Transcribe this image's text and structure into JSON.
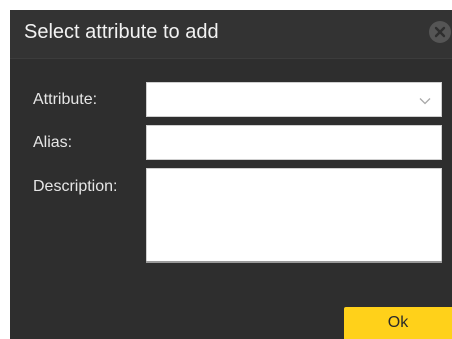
{
  "dialog": {
    "title": "Select attribute to add",
    "close_icon": "close-circle-icon"
  },
  "form": {
    "attribute": {
      "label": "Attribute:",
      "value": "",
      "icon": "chevron-down-icon"
    },
    "alias": {
      "label": "Alias:",
      "value": "",
      "placeholder": ""
    },
    "description": {
      "label": "Description:",
      "value": "",
      "placeholder": ""
    }
  },
  "actions": {
    "ok_label": "Ok"
  },
  "colors": {
    "dialog_background": "#2e2e2e",
    "title_bar": "#333333",
    "label_text": "#e6e6e6",
    "field_background": "#ffffff",
    "accent": "#ffd11a"
  }
}
